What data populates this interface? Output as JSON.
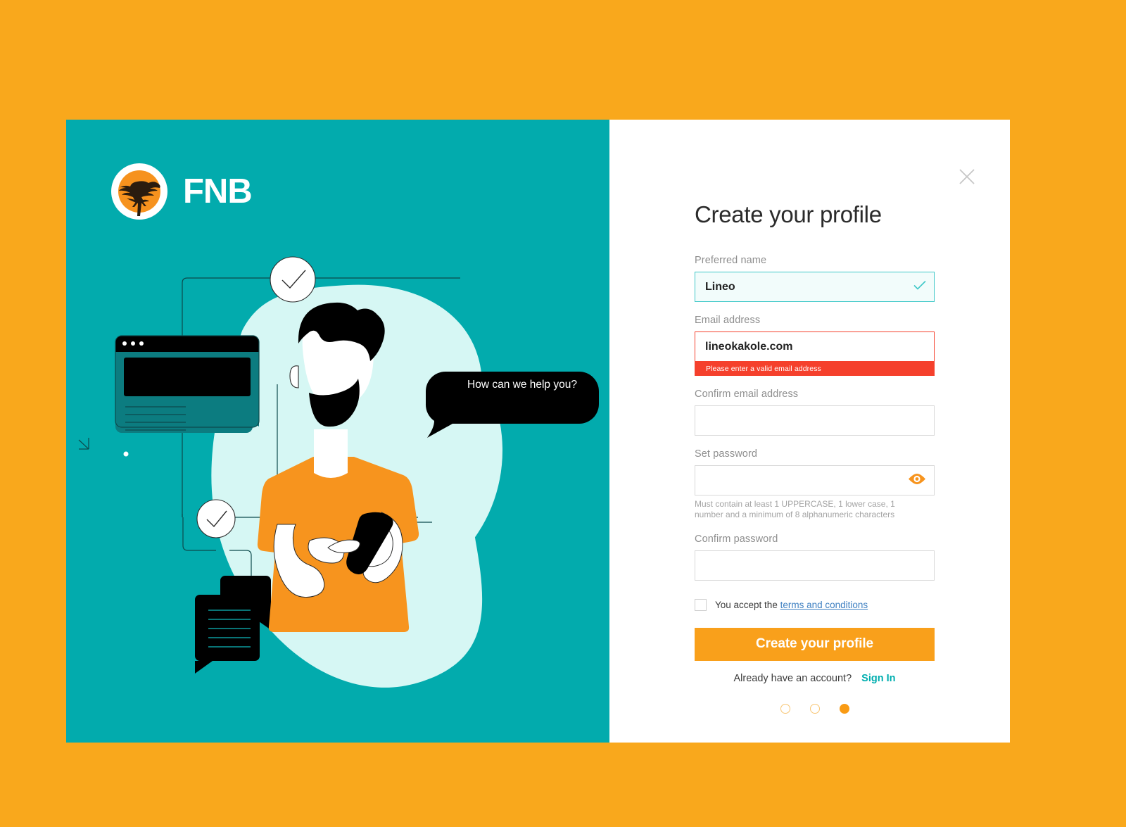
{
  "theme": {
    "page_background": "#F9A81C",
    "panel_teal": "#02ABAD",
    "accent_orange": "#F9A01B",
    "error_red": "#F5402C",
    "valid_teal": "#3fc8c8",
    "link_blue": "#3d7fc1",
    "signin_teal": "#00AEAF",
    "mint_blob": "#D6F7F4",
    "dark_teal": "#0C7C80"
  },
  "brand": {
    "logo_icon": "acacia-tree-logo-icon",
    "name": "FNB"
  },
  "illustration": {
    "speech_bubble_text": "How can we help you?",
    "check_badges": 2,
    "browser_window_icon": "browser-window-illustration",
    "chat_bubbles_icon": "chat-bubbles-illustration",
    "person_icon": "person-with-phone-illustration"
  },
  "form": {
    "close_icon": "close-icon",
    "title": "Create your profile",
    "fields": [
      {
        "id": "preferred-name",
        "label": "Preferred name",
        "value": "Lineo",
        "placeholder": "",
        "state": "valid",
        "status_icon": "check-icon"
      },
      {
        "id": "email-address",
        "label": "Email address",
        "value": "lineokakole.com",
        "placeholder": "",
        "state": "error",
        "error_message": "Please enter a valid email address"
      },
      {
        "id": "confirm-email-address",
        "label": "Confirm email address",
        "value": "",
        "placeholder": "",
        "state": "empty"
      },
      {
        "id": "set-password",
        "label": "Set password",
        "value": "",
        "placeholder": "",
        "state": "empty",
        "toggle_icon": "eye-icon",
        "hint": "Must contain at least 1 UPPERCASE, 1 lower case, 1 number and a minimum of 8 alphanumeric characters"
      },
      {
        "id": "confirm-password",
        "label": "Confirm password",
        "value": "",
        "placeholder": "",
        "state": "empty"
      }
    ],
    "terms": {
      "checked": false,
      "text_before": "You accept the",
      "link_label": "terms and conditions"
    },
    "submit_label": "Create your profile",
    "footer": {
      "prompt": "Already have an account?",
      "link_label": "Sign In"
    },
    "pager": {
      "total": 3,
      "active_index": 2
    }
  }
}
